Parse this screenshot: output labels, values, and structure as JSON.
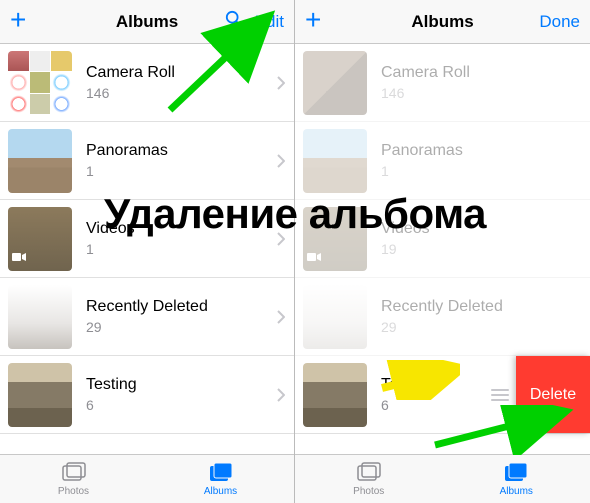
{
  "overlay_text": "Удаление альбома",
  "left": {
    "header": {
      "title": "Albums",
      "edit": "Edit"
    },
    "albums": [
      {
        "title": "Camera Roll",
        "count": "146"
      },
      {
        "title": "Panoramas",
        "count": "1"
      },
      {
        "title": "Videos",
        "count": "1"
      },
      {
        "title": "Recently Deleted",
        "count": "29"
      },
      {
        "title": "Testing",
        "count": "6"
      }
    ],
    "tabs": {
      "photos": "Photos",
      "albums": "Albums"
    }
  },
  "right": {
    "header": {
      "title": "Albums",
      "done": "Done"
    },
    "albums": [
      {
        "title": "Camera Roll",
        "count": "146"
      },
      {
        "title": "Panoramas",
        "count": "1"
      },
      {
        "title": "Videos",
        "count": "19"
      },
      {
        "title": "Recently Deleted",
        "count": "29"
      },
      {
        "title": "Testing",
        "count": "6"
      }
    ],
    "delete_label": "Delete",
    "tabs": {
      "photos": "Photos",
      "albums": "Albums"
    }
  }
}
